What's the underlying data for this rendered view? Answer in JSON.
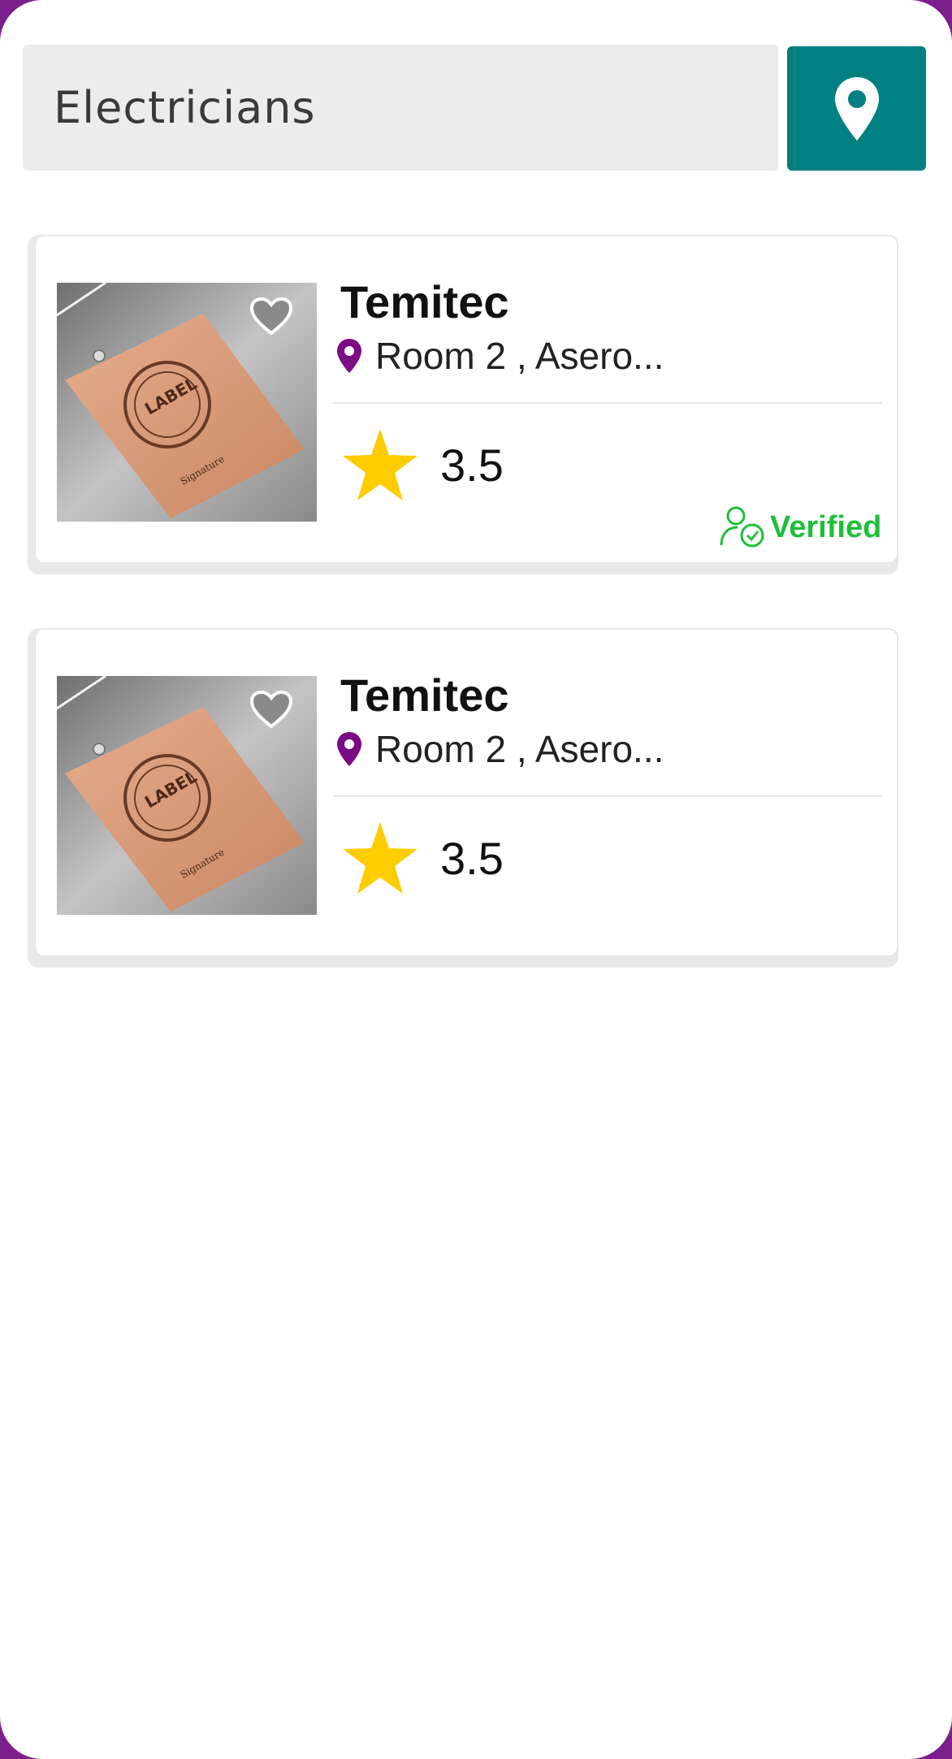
{
  "search": {
    "value": "Electricians"
  },
  "colors": {
    "accent": "#008080",
    "brand": "#7b1f8c",
    "pin": "#7b0a85",
    "star": "#ffcc00",
    "verified": "#1dbf3a"
  },
  "listings": [
    {
      "name": "Temitec",
      "address": "Room 2 , Asero...",
      "rating": "3.5",
      "verified_label": "Verified",
      "thumbnail_icon": "label-mockup-image",
      "favorite_icon": "heart-icon"
    },
    {
      "name": "Temitec",
      "address": "Room 2 , Asero...",
      "rating": "3.5",
      "thumbnail_icon": "label-mockup-image",
      "favorite_icon": "heart-icon"
    }
  ]
}
